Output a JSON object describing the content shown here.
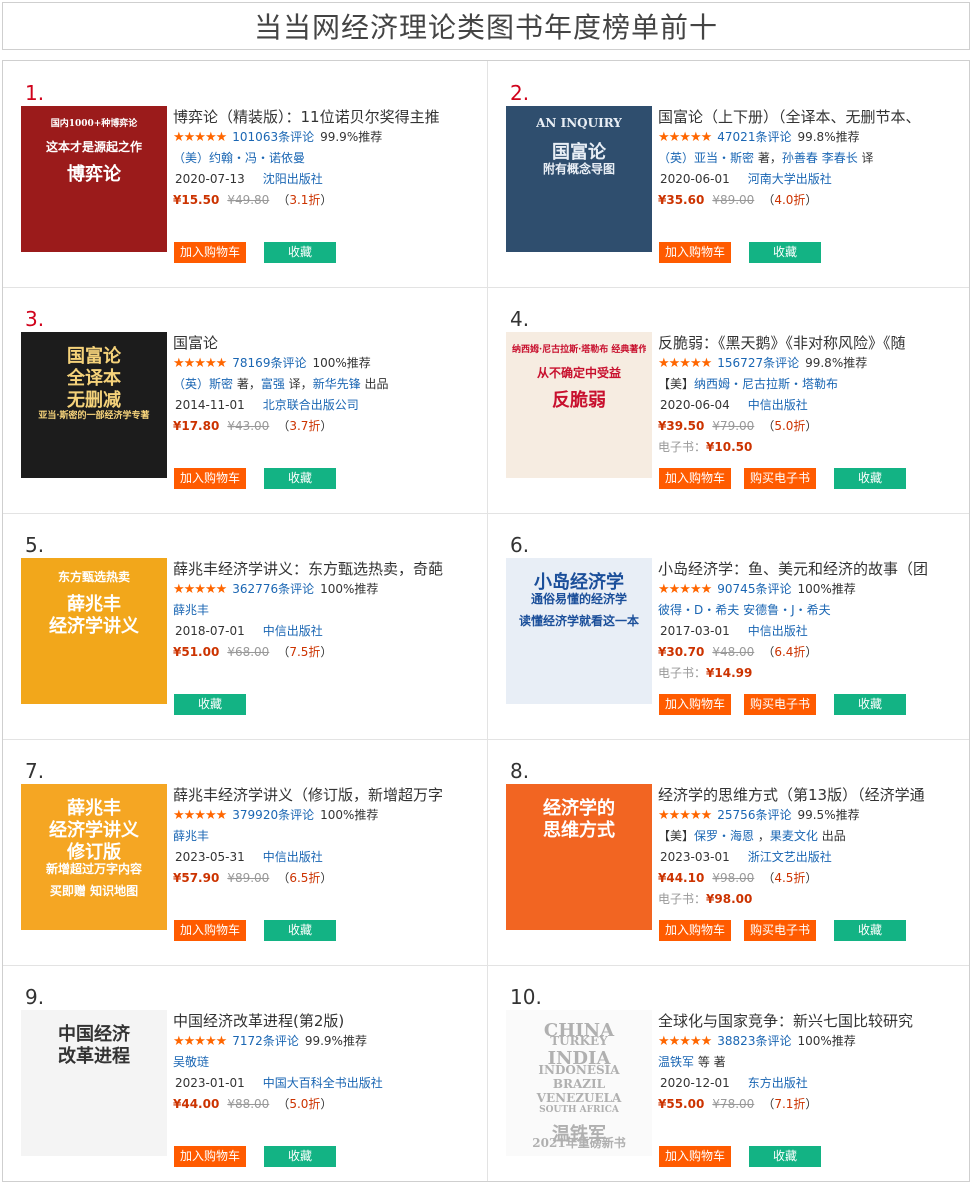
{
  "page_title": "当当网经济理论类图书年度榜单前十",
  "labels": {
    "add_cart": "加入购物车",
    "favorite": "收藏",
    "buy_ebook": "购买电子书",
    "ebook_prefix": "电子书：",
    "discount_open": "（",
    "discount_close": "）"
  },
  "colors": {
    "cart": "#ff5b00",
    "favorite": "#13b384",
    "price": "#cc3300",
    "link": "#1a66b3",
    "rank_top": "#d0021b"
  },
  "books": [
    {
      "rank": "1.",
      "title": "博弈论（精装版）：11位诺贝尔奖得主推",
      "stars": "★★★★★",
      "reviews": "101063条评论",
      "recommend": "99.9%推荐",
      "author_parts": [
        "（美）约翰・冯・诺依曼"
      ],
      "date": "2020-07-13",
      "publisher": "沈阳出版社",
      "price": "¥15.50",
      "orig_price": "¥49.80",
      "discount": "3.1折",
      "ebook_price": null,
      "cover_lines": [
        "国内1000+种博弈论",
        "这本才是源起之作",
        "博弈论"
      ]
    },
    {
      "rank": "2.",
      "title": "国富论（上下册）（全译本、无删节本、",
      "stars": "★★★★★",
      "reviews": "47021条评论",
      "recommend": "99.8%推荐",
      "author_parts": [
        "（英）亚当・斯密",
        " 著，",
        "孙善春",
        " ",
        "李春长",
        " 译"
      ],
      "date": "2020-06-01",
      "publisher": "河南大学出版社",
      "price": "¥35.60",
      "orig_price": "¥89.00",
      "discount": "4.0折",
      "ebook_price": null,
      "cover_lines": [
        "AN INQUIRY",
        "国富论",
        "附有概念导图"
      ]
    },
    {
      "rank": "3.",
      "title": "国富论",
      "stars": "★★★★★",
      "reviews": "78169条评论",
      "recommend": "100%推荐",
      "author_parts": [
        "（英）斯密",
        " 著，",
        "富强",
        " 译，",
        "新华先锋",
        " 出品"
      ],
      "date": "2014-11-01",
      "publisher": "北京联合出版公司",
      "price": "¥17.80",
      "orig_price": "¥43.00",
      "discount": "3.7折",
      "ebook_price": null,
      "cover_lines": [
        "国富论",
        "全译本",
        "无删减",
        "亚当·斯密的一部经济学专著"
      ]
    },
    {
      "rank": "4.",
      "title": "反脆弱：《黑天鹅》《非对称风险》《随",
      "stars": "★★★★★",
      "reviews": "156727条评论",
      "recommend": "99.8%推荐",
      "author_parts": [
        "【美】",
        "纳西姆・尼古拉斯・塔勒布"
      ],
      "date": "2020-06-04",
      "publisher": "中信出版社",
      "price": "¥39.50",
      "orig_price": "¥79.00",
      "discount": "5.0折",
      "ebook_price": "¥10.50",
      "cover_lines": [
        "纳西姆·尼古拉斯·塔勒布 经典著作",
        "从不确定中受益",
        "反脆弱"
      ]
    },
    {
      "rank": "5.",
      "title": "薛兆丰经济学讲义：东方甄选热卖，奇葩",
      "stars": "★★★★★",
      "reviews": "362776条评论",
      "recommend": "100%推荐",
      "author_parts": [
        "薛兆丰"
      ],
      "date": "2018-07-01",
      "publisher": "中信出版社",
      "price": "¥51.00",
      "orig_price": "¥68.00",
      "discount": "7.5折",
      "ebook_price": null,
      "cover_lines": [
        "东方甄选热卖",
        "薛兆丰",
        "经济学讲义"
      ]
    },
    {
      "rank": "6.",
      "title": "小岛经济学：鱼、美元和经济的故事（团",
      "stars": "★★★★★",
      "reviews": "90745条评论",
      "recommend": "100%推荐",
      "author_parts": [
        "彼得・D・希夫",
        " ",
        "安德鲁・J・希夫"
      ],
      "date": "2017-03-01",
      "publisher": "中信出版社",
      "price": "¥30.70",
      "orig_price": "¥48.00",
      "discount": "6.4折",
      "ebook_price": "¥14.99",
      "cover_lines": [
        "小岛经济学",
        "通俗易懂的经济学",
        "读懂经济学就看这一本"
      ]
    },
    {
      "rank": "7.",
      "title": "薛兆丰经济学讲义（修订版，新增超万字",
      "stars": "★★★★★",
      "reviews": "379920条评论",
      "recommend": "100%推荐",
      "author_parts": [
        "薛兆丰"
      ],
      "date": "2023-05-31",
      "publisher": "中信出版社",
      "price": "¥57.90",
      "orig_price": "¥89.00",
      "discount": "6.5折",
      "ebook_price": null,
      "cover_lines": [
        "薛兆丰",
        "经济学讲义",
        "修订版",
        "新增超过万字内容",
        "买即赠 知识地图"
      ]
    },
    {
      "rank": "8.",
      "title": "经济学的思维方式（第13版）（经济学通",
      "stars": "★★★★★",
      "reviews": "25756条评论",
      "recommend": "99.5%推荐",
      "author_parts": [
        "【美】",
        "保罗・海恩",
        " ，",
        "果麦文化",
        " 出品"
      ],
      "date": "2023-03-01",
      "publisher": "浙江文艺出版社",
      "price": "¥44.10",
      "orig_price": "¥98.00",
      "discount": "4.5折",
      "ebook_price": "¥98.00",
      "cover_lines": [
        "经济学的",
        "思维方式"
      ]
    },
    {
      "rank": "9.",
      "title": "中国经济改革进程(第2版)",
      "stars": "★★★★★",
      "reviews": "7172条评论",
      "recommend": "99.9%推荐",
      "author_parts": [
        "吴敬琏"
      ],
      "date": "2023-01-01",
      "publisher": "中国大百科全书出版社",
      "price": "¥44.00",
      "orig_price": "¥88.00",
      "discount": "5.0折",
      "ebook_price": null,
      "cover_lines": [
        "中国经济",
        "改革进程"
      ]
    },
    {
      "rank": "10.",
      "title": "全球化与国家竞争：新兴七国比较研究",
      "stars": "★★★★★",
      "reviews": "38823条评论",
      "recommend": "100%推荐",
      "author_parts": [
        "温铁军",
        " 等 著"
      ],
      "date": "2020-12-01",
      "publisher": "东方出版社",
      "price": "¥55.00",
      "orig_price": "¥78.00",
      "discount": "7.1折",
      "ebook_price": null,
      "cover_lines": [
        "CHINA",
        "TURKEY",
        "INDIA",
        "INDONESIA",
        "BRAZIL",
        "VENEZUELA",
        "SOUTH AFRICA",
        "温铁军",
        "2021年重磅新书"
      ]
    }
  ]
}
